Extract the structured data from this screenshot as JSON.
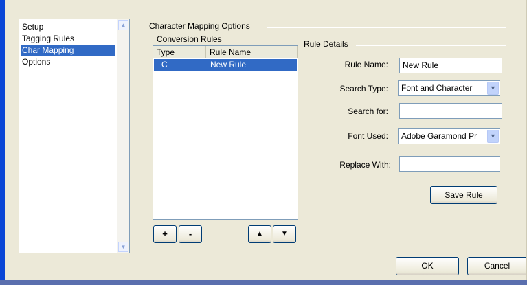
{
  "nav": {
    "items": [
      {
        "label": "Setup"
      },
      {
        "label": "Tagging Rules"
      },
      {
        "label": "Char Mapping"
      },
      {
        "label": "Options"
      }
    ],
    "selected": "Char Mapping"
  },
  "main": {
    "group_title": "Character Mapping Options",
    "conversion_rules": {
      "title": "Conversion Rules",
      "columns": [
        "Type",
        "Rule Name"
      ],
      "rows": [
        {
          "type": "C",
          "name": "New Rule"
        }
      ],
      "add_label": "+",
      "remove_label": "-",
      "up_label": "▲",
      "down_label": "▼"
    },
    "rule_details": {
      "title": "Rule Details",
      "rule_name_label": "Rule Name:",
      "rule_name_value": "New Rule",
      "search_type_label": "Search Type:",
      "search_type_value": "Font and Character",
      "search_for_label": "Search for:",
      "search_for_value": "",
      "font_used_label": "Font Used:",
      "font_used_value": "Adobe Garamond Pr",
      "replace_with_label": "Replace With:",
      "replace_with_value": "",
      "save_label": "Save Rule"
    }
  },
  "footer": {
    "ok_label": "OK",
    "cancel_label": "Cancel"
  },
  "icons": {
    "dropdown": "chevron-down-icon",
    "scroll_up": "scroll-up-arrow-icon",
    "scroll_down": "scroll-down-arrow-icon"
  }
}
